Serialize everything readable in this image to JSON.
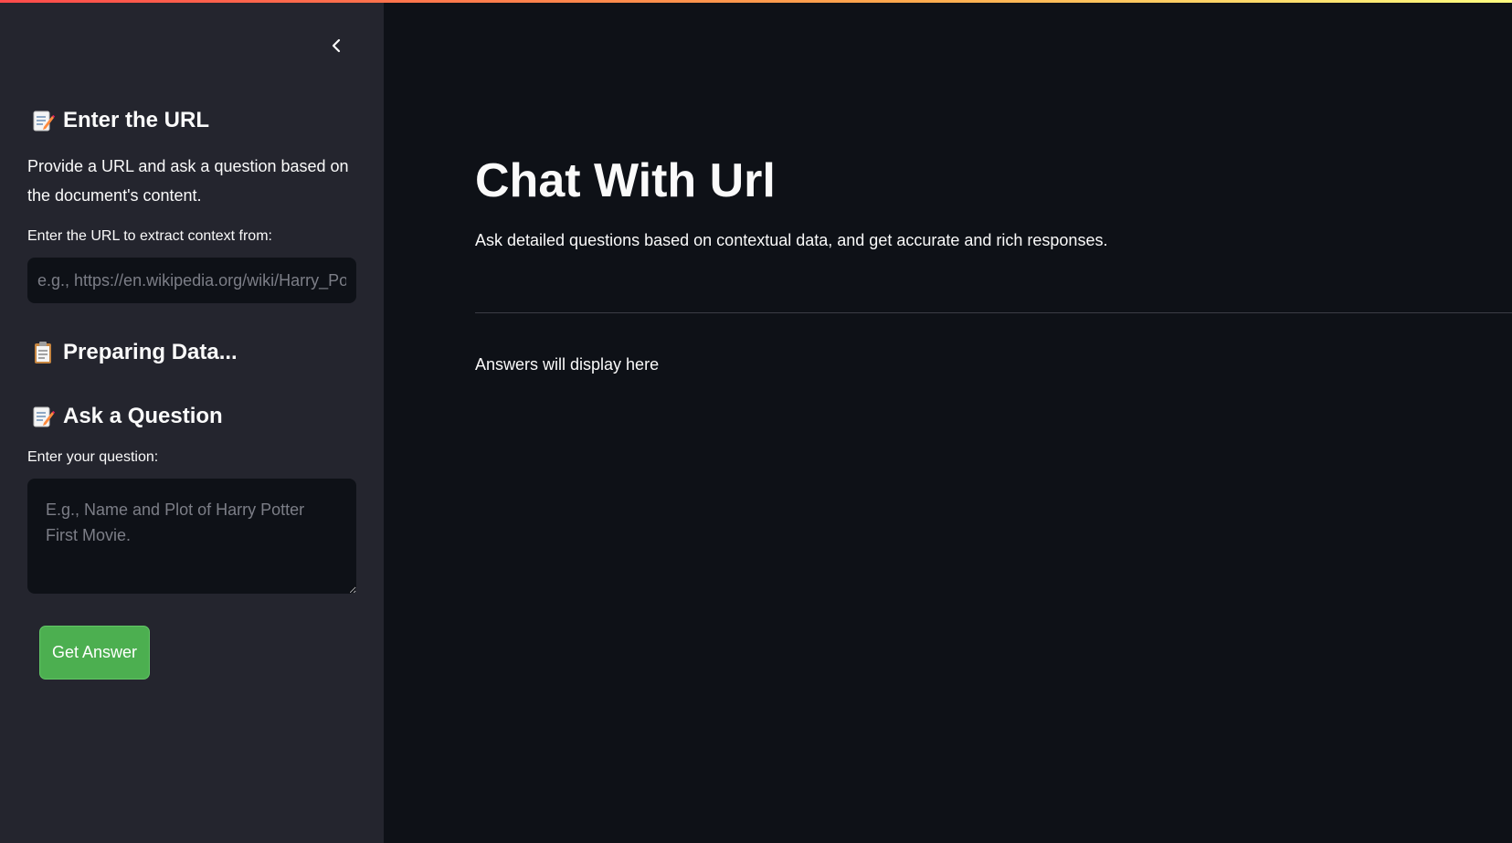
{
  "sidebar": {
    "collapse_icon": "chevron-left-icon",
    "url_section": {
      "emoji": "memo-icon",
      "header": "Enter the URL",
      "description": "Provide a URL and ask a question based on the document's content.",
      "input_label": "Enter the URL to extract context from:",
      "input_placeholder": "e.g., https://en.wikipedia.org/wiki/Harry_Potter",
      "input_value": ""
    },
    "status": {
      "emoji": "clipboard-icon",
      "header": "Preparing Data..."
    },
    "question_section": {
      "emoji": "memo-icon",
      "header": "Ask a Question",
      "input_label": "Enter your question:",
      "input_placeholder": "E.g., Name and Plot of Harry Potter First Movie.",
      "input_value": ""
    },
    "button_label": "Get Answer"
  },
  "main": {
    "title": "Chat With Url",
    "subtitle": "Ask detailed questions based on contextual data, and get accurate and rich responses.",
    "answer_placeholder": "Answers will display here"
  },
  "colors": {
    "background": "#0e1117",
    "sidebar": "#24252e",
    "button": "#4caf50",
    "accent_gradient_start": "#ff4b4b",
    "accent_gradient_end": "#fffd80"
  }
}
